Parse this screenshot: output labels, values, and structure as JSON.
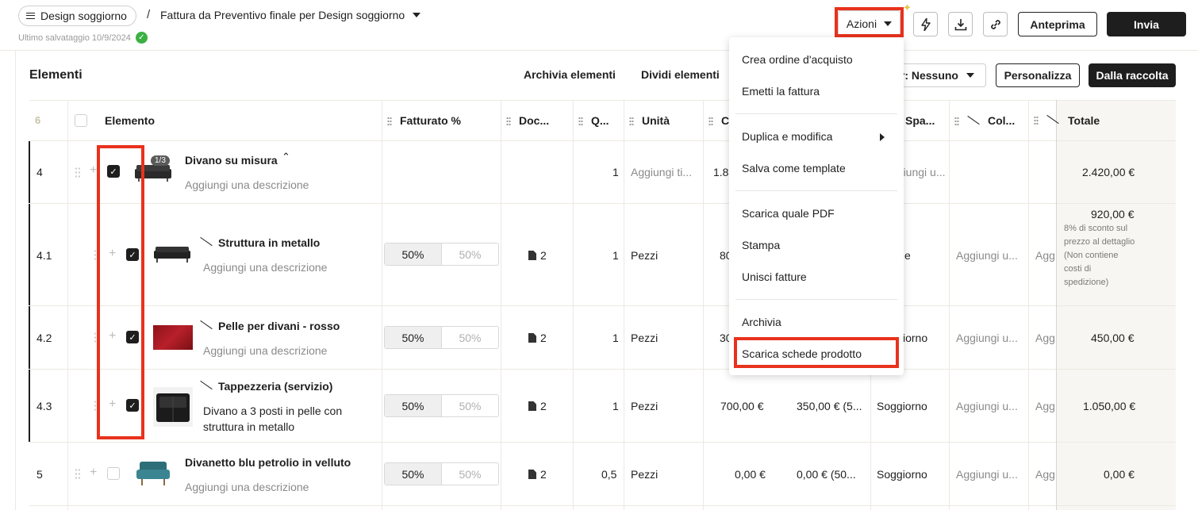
{
  "header": {
    "project": "Design soggiorno",
    "separator": "/",
    "doc_title": "Fattura da Preventivo finale per Design soggiorno",
    "saved": "Ultimo salvataggio 10/9/2024",
    "actions_label": "Azioni",
    "preview_label": "Anteprima",
    "send_label": "Invia",
    "icons": [
      "bolt-icon",
      "download-icon",
      "link-icon"
    ]
  },
  "toolbar": {
    "title": "Elementi",
    "archive": "Archivia elementi",
    "split": "Dividi elementi",
    "filter": "er: Nessuno",
    "customize": "Personalizza",
    "from_collection": "Dalla raccolta"
  },
  "table": {
    "count": "6",
    "headers": {
      "item": "Elemento",
      "billed": "Fatturato %",
      "docs": "Doc...",
      "qty": "Q...",
      "unit": "Unità",
      "c6": "C",
      "space": "Spa...",
      "col": "Col...",
      "total": "Totale"
    },
    "rows": [
      {
        "id": "4",
        "name": "Divano su misura",
        "desc": "Aggiungi una descrizione",
        "badge": "1/3",
        "qty": "1",
        "unit": "Aggiungi ti...",
        "cost": "1.80",
        "space": "ggiungi u...",
        "total": "2.420,00 €"
      },
      {
        "id": "4.1",
        "name": "Struttura in metallo",
        "desc": "Aggiungi una descrizione",
        "billed_a": "50%",
        "billed_b": "50%",
        "docs": "2",
        "qty": "1",
        "unit": "Pezzi",
        "cost": "80",
        "space": "e",
        "col": "Aggiungi u...",
        "extra": "Agg",
        "total": "920,00 €",
        "note": "8% di sconto sul prezzo al dettaglio (Non contiene costi di spedizione)"
      },
      {
        "id": "4.2",
        "name": "Pelle per divani - rosso",
        "desc": "Aggiungi una descrizione",
        "billed_a": "50%",
        "billed_b": "50%",
        "docs": "2",
        "qty": "1",
        "unit": "Pezzi",
        "cost": "30",
        "space": "iorno",
        "col": "Aggiungi u...",
        "extra": "Agg",
        "total": "450,00 €"
      },
      {
        "id": "4.3",
        "name": "Tappezzeria (servizio)",
        "desc_line1": "Divano a 3 posti in pelle con",
        "desc_line2": "struttura in metallo",
        "billed_a": "50%",
        "billed_b": "50%",
        "docs": "2",
        "qty": "1",
        "unit": "Pezzi",
        "cost": "700,00 €",
        "price": "350,00 € (5...",
        "space": "Soggiorno",
        "col": "Aggiungi u...",
        "extra": "Agg",
        "total": "1.050,00 €"
      },
      {
        "id": "5",
        "name": "Divanetto blu petrolio in velluto",
        "desc": "Aggiungi una descrizione",
        "billed_a": "50%",
        "billed_b": "50%",
        "docs": "2",
        "qty": "0,5",
        "unit": "Pezzi",
        "cost": "0,00 €",
        "price": "0,00 € (50...",
        "space": "Soggiorno",
        "col": "Aggiungi u...",
        "extra": "Agg",
        "total": "0,00 €"
      }
    ]
  },
  "menu": {
    "items": [
      "Crea ordine d'acquisto",
      "Emetti la fattura",
      "Duplica e modifica",
      "Salva come template",
      "Scarica quale PDF",
      "Stampa",
      "Unisci fatture",
      "Archivia",
      "Scarica schede prodotto"
    ]
  },
  "colors": {
    "highlight": "#e8321d",
    "primary": "#1e1e1e",
    "saved_check": "#3cb043"
  }
}
